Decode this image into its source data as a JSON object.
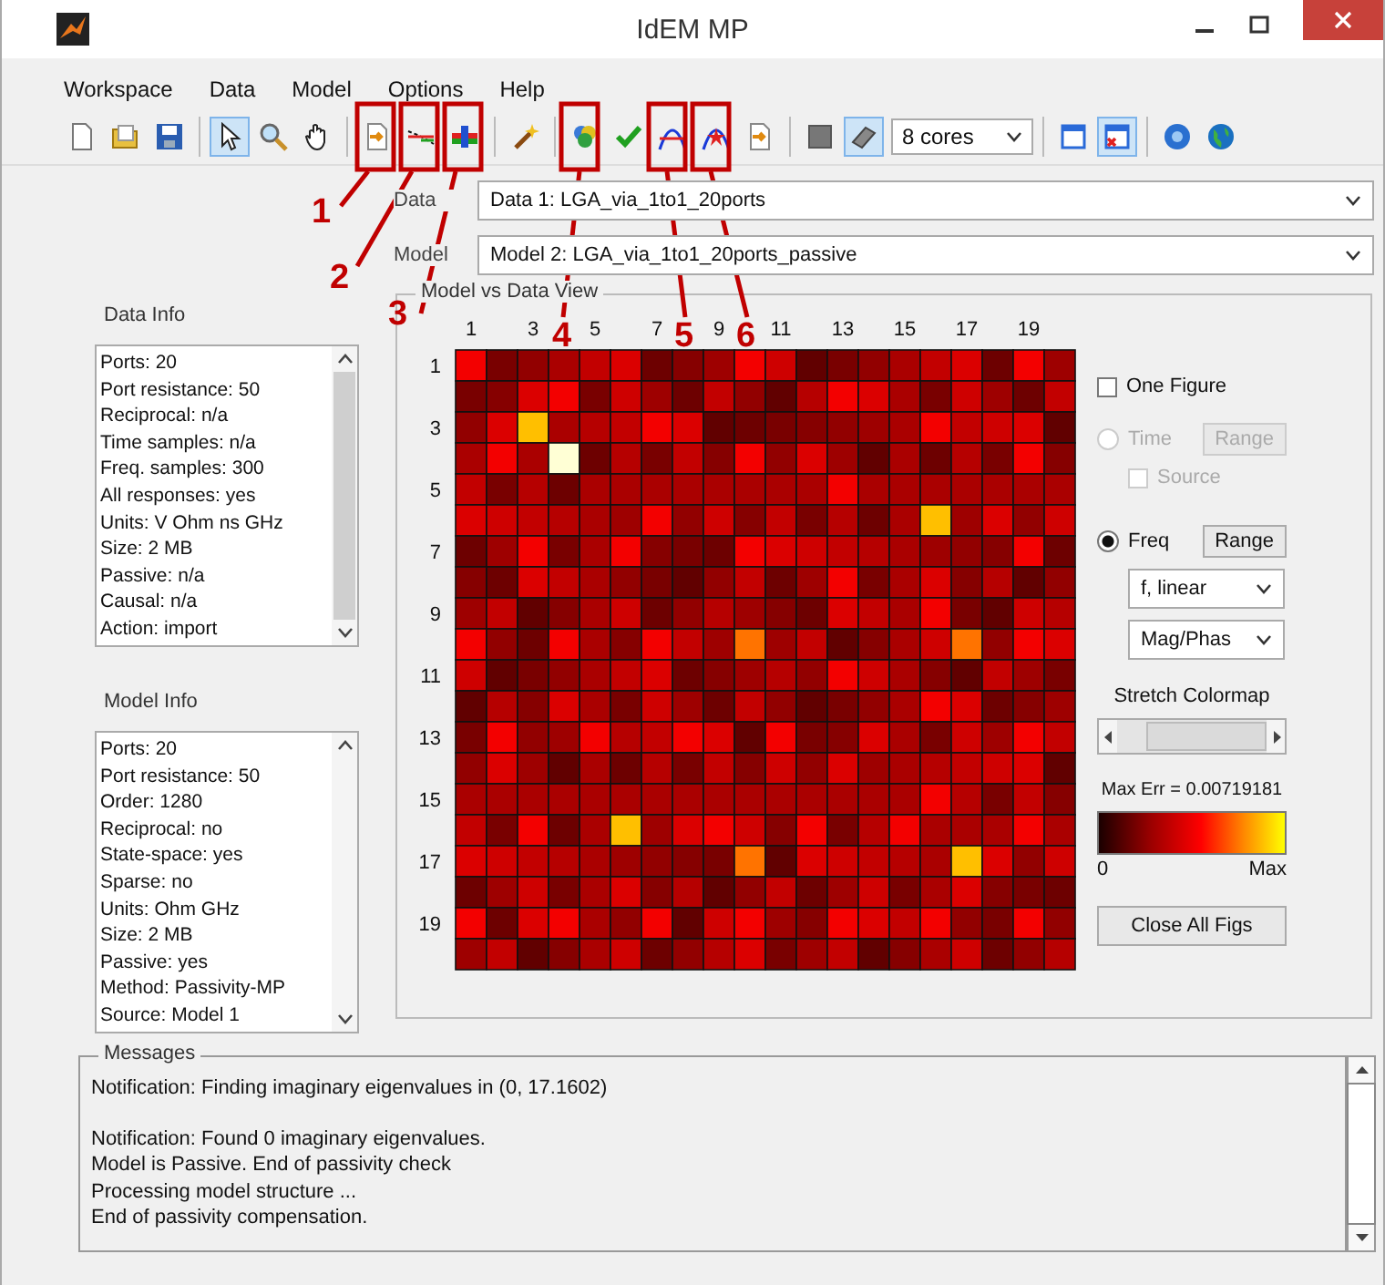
{
  "window": {
    "title": "IdEM MP"
  },
  "menu": [
    "Workspace",
    "Data",
    "Model",
    "Options",
    "Help"
  ],
  "toolbar": {
    "groups": [
      [
        {
          "kind": "new",
          "selected": false
        },
        {
          "kind": "open",
          "selected": false
        },
        {
          "kind": "save",
          "selected": false
        }
      ],
      [
        {
          "kind": "pointer",
          "selected": true
        },
        {
          "kind": "zoom",
          "selected": false
        },
        {
          "kind": "pan",
          "selected": false
        }
      ],
      [
        {
          "kind": "import",
          "selected": false
        },
        {
          "kind": "line-fit",
          "selected": false
        },
        {
          "kind": "bar-fit",
          "selected": false
        }
      ],
      [
        {
          "kind": "wand",
          "selected": false
        }
      ],
      [
        {
          "kind": "shapes",
          "selected": false
        },
        {
          "kind": "check",
          "selected": false
        },
        {
          "kind": "curve",
          "selected": false
        },
        {
          "kind": "curve-star",
          "selected": false
        },
        {
          "kind": "export",
          "selected": false
        }
      ],
      [
        {
          "kind": "stop",
          "selected": false
        },
        {
          "kind": "eraser",
          "selected": true
        },
        {
          "kind": "cores",
          "value": "8 cores"
        }
      ],
      [
        {
          "kind": "window",
          "selected": false
        },
        {
          "kind": "close-figs",
          "selected": true
        }
      ],
      [
        {
          "kind": "help",
          "selected": false
        },
        {
          "kind": "globe",
          "selected": false
        }
      ]
    ]
  },
  "selectors": [
    {
      "label": "Data",
      "value": "Data 1: LGA_via_1to1_20ports"
    },
    {
      "label": "Model",
      "value": "Model 2: LGA_via_1to1_20ports_passive"
    }
  ],
  "data_info": {
    "title": "Data Info",
    "lines": [
      "Ports: 20",
      "Port resistance: 50",
      "Reciprocal: n/a",
      "Time samples: n/a",
      "Freq. samples: 300",
      "All responses: yes",
      "Units: V Ohm ns GHz",
      "Size: 2 MB",
      "Passive: n/a",
      "Causal: n/a",
      "Action: import"
    ]
  },
  "model_info": {
    "title": "Model Info",
    "lines": [
      "Ports: 20",
      "Port resistance: 50",
      "Order: 1280",
      "Reciprocal: no",
      "State-space: yes",
      "Sparse: no",
      "Units: Ohm GHz",
      "Size: 2 MB",
      "Passive: yes",
      "Method: Passivity-MP",
      "Source: Model 1"
    ]
  },
  "view": {
    "title": "Model vs Data View",
    "x_labels": [
      "1",
      "3",
      "5",
      "7",
      "9",
      "11",
      "13",
      "15",
      "17",
      "19"
    ],
    "y_labels": [
      "1",
      "3",
      "5",
      "7",
      "9",
      "11",
      "13",
      "15",
      "17",
      "19"
    ],
    "one_figure": {
      "label": "One Figure",
      "checked": false
    },
    "time": {
      "label": "Time",
      "selected": false,
      "disabled": true,
      "range": "Range"
    },
    "source": {
      "label": "Source",
      "checked": false,
      "disabled": true
    },
    "freq": {
      "label": "Freq",
      "selected": true,
      "disabled": false,
      "range": "Range"
    },
    "scale": "f, linear",
    "format": "Mag/Phas",
    "stretch": {
      "label": "Stretch Colormap",
      "level": 1
    },
    "max_err": "Max Err = 0.00719181",
    "colorbar": {
      "min": "0",
      "max": "Max"
    },
    "close_button": "Close All Figs"
  },
  "messages": {
    "title": "Messages",
    "paragraphs": [
      [
        "Notification: Finding imaginary eigenvalues in (0, 17.1602)"
      ],
      [
        "Notification: Found 0 imaginary eigenvalues.",
        "Model is Passive. End of passivity check",
        "Processing model structure ...",
        "End of passivity compensation."
      ]
    ]
  },
  "callouts": [
    "1",
    "2",
    "3",
    "4",
    "5",
    "6"
  ]
}
